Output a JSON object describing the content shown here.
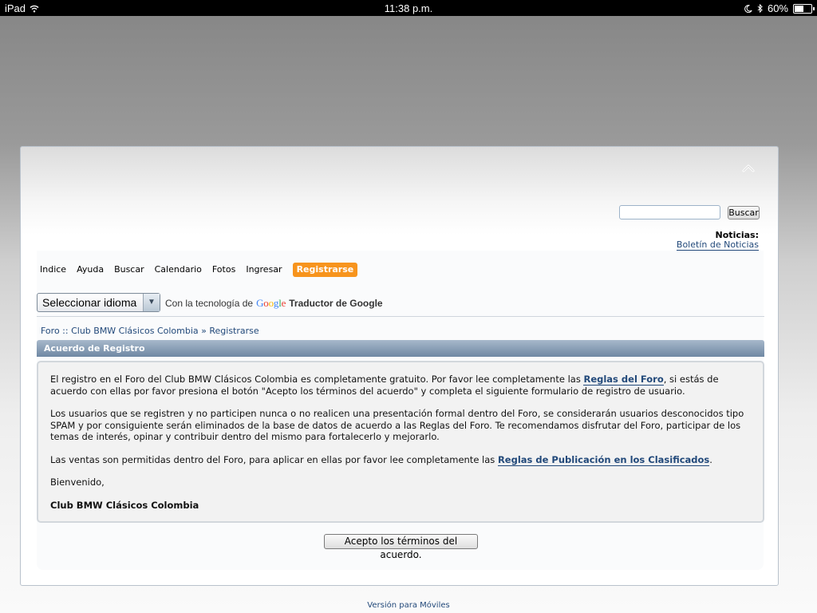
{
  "statusbar": {
    "device": "iPad",
    "time": "11:38 p.m.",
    "battery": "60%",
    "battery_level": 0.6
  },
  "header": {
    "search_button": "Buscar",
    "search_placeholder": "",
    "news_label": "Noticias:",
    "news_link": "Boletín de Noticias"
  },
  "nav": {
    "items": [
      "Indice",
      "Ayuda",
      "Buscar",
      "Calendario",
      "Fotos",
      "Ingresar"
    ],
    "active": "Registrarse"
  },
  "translate": {
    "select_value": "Seleccionar idioma",
    "powered_by": "Con la tecnología de",
    "google": "Google",
    "translator": "Traductor de Google"
  },
  "breadcrumb": {
    "root": "Foro :: Club BMW Clásicos Colombia",
    "separator": "»",
    "current": "Registrarse"
  },
  "section": {
    "title": "Acuerdo de Registro",
    "p1_before": "El registro en el Foro del Club BMW Clásicos Colombia es completamente gratuito. Por favor lee completamente las ",
    "p1_link": "Reglas del Foro",
    "p1_after": ", si estás de acuerdo con ellas por favor presiona el botón \"Acepto los términos del acuerdo\" y completa el siguiente formulario de registro de usuario.",
    "p2": "Los usuarios que se registren y no participen nunca o no realicen una presentación formal dentro del Foro, se considerarán usuarios desconocidos tipo SPAM y por consiguiente serán eliminados de la base de datos de acuerdo a las Reglas del Foro. Te recomendamos disfrutar del Foro, participar de los temas de interés, opinar y contribuir dentro del mismo para fortalecerlo y mejorarlo.",
    "p3_before": "Las ventas son permitidas dentro del Foro, para aplicar en ellas por favor lee completamente las ",
    "p3_link": "Reglas de Publicación en los Clasificados",
    "p3_after": ".",
    "greeting": "Bienvenido,",
    "signature": "Club BMW Clásicos Colombia"
  },
  "accept_button": "Acepto los términos del acuerdo.",
  "footer": {
    "mobile_link": "Versión para Móviles"
  },
  "colors": {
    "accent": "#f7941d",
    "link": "#22497a",
    "section_bar": "#6f88a3"
  },
  "icons": [
    "wifi-icon",
    "moon-icon",
    "bluetooth-icon",
    "battery-icon",
    "collapse-icon",
    "dropdown-arrow-icon"
  ]
}
